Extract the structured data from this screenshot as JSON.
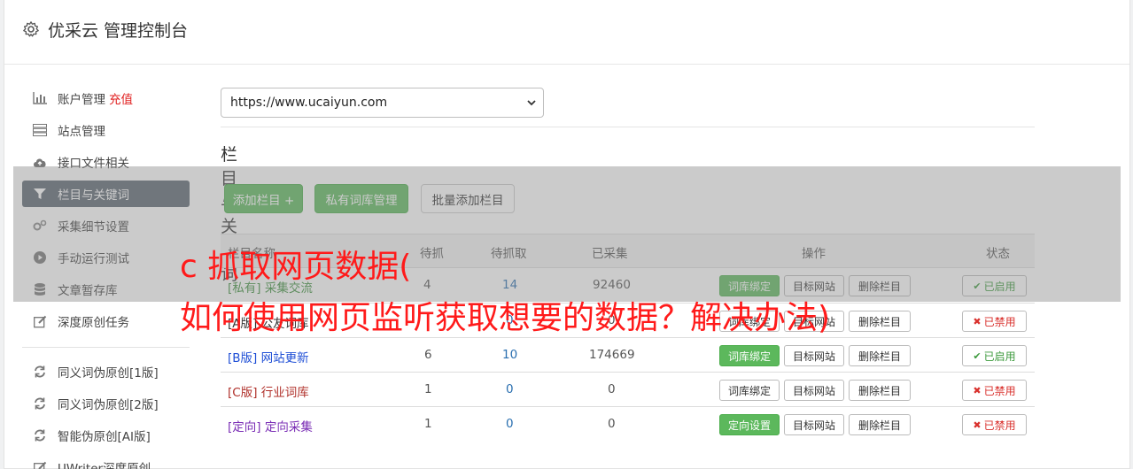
{
  "header": {
    "title": "优采云 管理控制台",
    "icon": "gear-icon"
  },
  "sidebar": {
    "items": [
      {
        "label": "账户管理",
        "badge": "充值",
        "icon": "bar-chart-icon"
      },
      {
        "label": "站点管理",
        "icon": "server-icon"
      },
      {
        "label": "接口文件相关",
        "icon": "cloud-upload-icon"
      },
      {
        "label": "栏目与关键词",
        "icon": "filter-icon",
        "active": true
      },
      {
        "label": "采集细节设置",
        "icon": "gears-icon"
      },
      {
        "label": "手动运行测试",
        "icon": "play-circle-icon"
      },
      {
        "label": "文章暂存库",
        "icon": "database-icon"
      },
      {
        "label": "深度原创任务",
        "icon": "edit-icon"
      },
      {
        "label": "同义词伪原创[1版]",
        "icon": "refresh-icon"
      },
      {
        "label": "同义词伪原创[2版]",
        "icon": "refresh-icon"
      },
      {
        "label": "智能伪原创[AI版]",
        "icon": "refresh-icon"
      },
      {
        "label": "UWriter深度原创",
        "icon": "edit-icon"
      }
    ]
  },
  "main": {
    "site_select": "https://www.ucaiyun.com",
    "section_title": "栏目与关键词",
    "buttons": {
      "add_column": "添加栏目 +",
      "private_lib": "私有词库管理",
      "batch_add": "批量添加栏目"
    },
    "table": {
      "headers": [
        "栏目名称",
        "待抓",
        "待抓取",
        "已采集",
        "操作",
        "状态"
      ],
      "rows": [
        {
          "name": "[私有] 采集交流",
          "a": "4",
          "b": "14",
          "c": "92460",
          "op1": "词库绑定",
          "op2": "目标网站",
          "op3": "删除栏目",
          "status": "已启用",
          "status_on": true,
          "color": "#3c8f3c"
        },
        {
          "name": "[A版] 公友词库",
          "a": "",
          "b": "0",
          "c": "0",
          "op1": "词库绑定",
          "op2": "目标网站",
          "op3": "删除栏目",
          "status": "已禁用",
          "status_on": false,
          "color": "#333333"
        },
        {
          "name": "[B版] 网站更新",
          "a": "6",
          "b": "10",
          "c": "174669",
          "op1": "词库绑定",
          "op2": "目标网站",
          "op3": "删除栏目",
          "status": "已启用",
          "status_on": true,
          "color": "#1f4fd6"
        },
        {
          "name": "[C版] 行业词库",
          "a": "1",
          "b": "0",
          "c": "0",
          "op1": "词库绑定",
          "op2": "目标网站",
          "op3": "删除栏目",
          "status": "已禁用",
          "status_on": false,
          "color": "#b0302a"
        },
        {
          "name": "[定向] 定向采集",
          "a": "1",
          "b": "0",
          "c": "0",
          "op1": "定向设置",
          "op2": "目标网站",
          "op3": "删除栏目",
          "status": "已禁用",
          "status_on": false,
          "color": "#7a2db5"
        }
      ]
    }
  },
  "overlay": {
    "line1": "c 抓取网页数据(",
    "line2": "如何使用网页监听获取想要的数据？解决办法)"
  }
}
